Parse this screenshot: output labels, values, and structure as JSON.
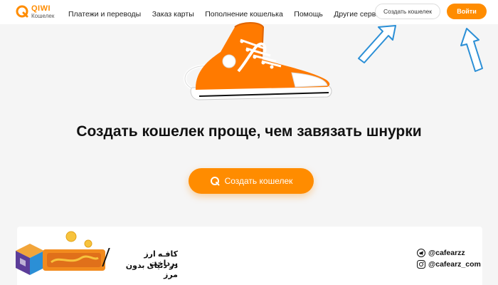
{
  "header": {
    "logo_title": "QIWI",
    "logo_subtitle": "Кошелек",
    "nav": [
      "Платежи и переводы",
      "Заказ карты",
      "Пополнение кошелька",
      "Помощь",
      "Другие сервисы..."
    ],
    "create_wallet_label": "Создать кошелек",
    "login_label": "Войти"
  },
  "hero": {
    "headline": "Создать кошелек проще, чем завязать шнурки",
    "cta_label": "Создать кошелек"
  },
  "watermark": {
    "line1": "کافـه ارز پرداخت",
    "line2": "در دنیای بدون مرز",
    "handle_telegram": "@cafearzz",
    "handle_instagram": "@cafearz_com"
  },
  "colors": {
    "accent": "#ff8c00",
    "arrow": "#2b8fd6"
  }
}
